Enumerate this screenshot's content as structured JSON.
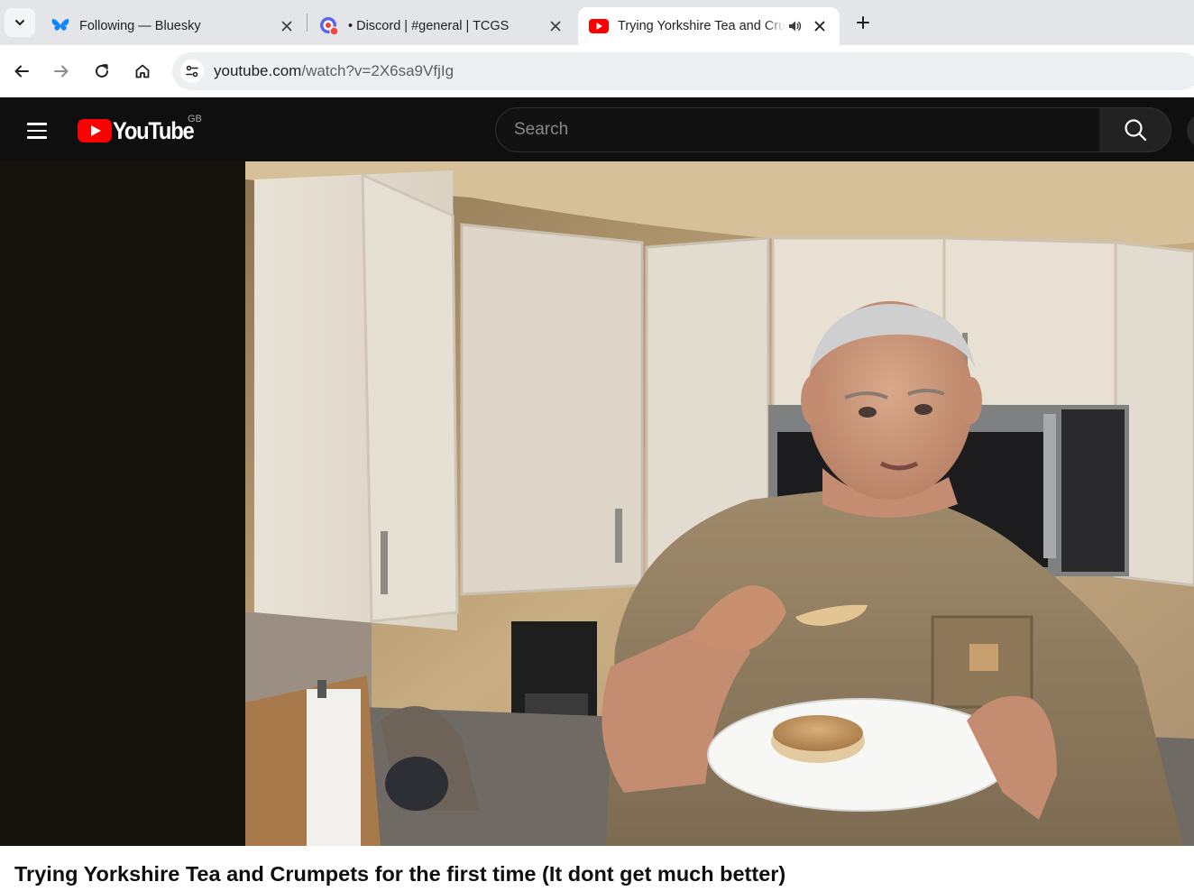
{
  "browser": {
    "tabs": [
      {
        "label": "Following — Bluesky",
        "favicon": "bluesky-butterfly-icon",
        "active": false
      },
      {
        "label": "• Discord | #general | TCGS",
        "favicon": "discord-icon",
        "active": false
      },
      {
        "label": "Trying Yorkshire Tea and Crumpets for the first time (It dont get much better)",
        "favicon": "youtube-icon",
        "active": true,
        "audio": true
      }
    ],
    "url_domain": "youtube.com",
    "url_path": "/watch?v=2X6sa9VfjIg"
  },
  "youtube": {
    "logo_text": "YouTube",
    "region": "GB",
    "search_placeholder": "Search"
  },
  "video": {
    "title": "Trying Yorkshire Tea and Crumpets for the first time (It dont get much better)"
  },
  "colors": {
    "masthead_bg": "#0f0f0f",
    "brand_red": "#ff0000",
    "tabstrip_bg": "#e3e5e8",
    "bluesky_blue": "#1185fe",
    "discord_blurple": "#5865f2"
  }
}
